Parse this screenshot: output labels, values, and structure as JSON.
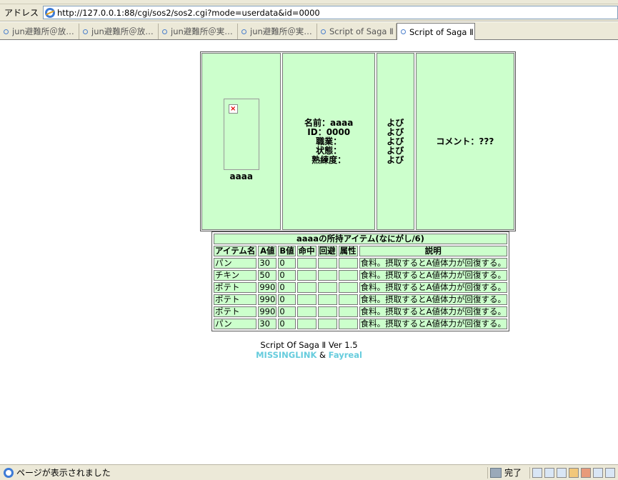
{
  "browser": {
    "address_label": "アドレス",
    "url": "http://127.0.0.1:88/cgi/sos2/sos2.cgi?mode=userdata&id=0000",
    "tabs": [
      {
        "label": "jun避難所＠放…",
        "active": false
      },
      {
        "label": "jun避難所＠放…",
        "active": false
      },
      {
        "label": "jun避難所＠実…",
        "active": false
      },
      {
        "label": "jun避難所＠実…",
        "active": false
      },
      {
        "label": "Script of Saga Ⅱ",
        "active": false
      },
      {
        "label": "Script of Saga Ⅱ",
        "active": true
      }
    ],
    "status_text": "ページが表示されました",
    "status_done": "完了"
  },
  "profile": {
    "name": "aaaa",
    "info_lines": [
      "名前：aaaa",
      "ID：0000",
      "職業：",
      "状態：",
      "熟練度："
    ],
    "yobi": [
      "よび",
      "よび",
      "よび",
      "よび",
      "よび"
    ],
    "comment": "コメント：???"
  },
  "items_table": {
    "title": "aaaaの所持アイテム(なにがし/6)",
    "headers": [
      "アイテム名",
      "A値",
      "B値",
      "命中",
      "回避",
      "属性",
      "説明"
    ],
    "rows": [
      [
        "パン",
        "30",
        "0",
        "",
        "",
        "",
        "食料。摂取するとA値体力が回復する。"
      ],
      [
        "チキン",
        "50",
        "0",
        "",
        "",
        "",
        "食料。摂取するとA値体力が回復する。"
      ],
      [
        "ポテト",
        "990",
        "0",
        "",
        "",
        "",
        "食料。摂取するとA値体力が回復する。"
      ],
      [
        "ポテト",
        "990",
        "0",
        "",
        "",
        "",
        "食料。摂取するとA値体力が回復する。"
      ],
      [
        "ポテト",
        "990",
        "0",
        "",
        "",
        "",
        "食料。摂取するとA値体力が回復する。"
      ],
      [
        "パン",
        "30",
        "0",
        "",
        "",
        "",
        "食料。摂取するとA値体力が回復する。"
      ]
    ]
  },
  "footer": {
    "version": "Script Of Saga Ⅱ Ver 1.5",
    "credit1": "MISSINGLINK",
    "amp": "&",
    "credit2": "Fayreal"
  },
  "colors": {
    "cell_bg": "#ccffcc",
    "link": "#66ccdd"
  }
}
